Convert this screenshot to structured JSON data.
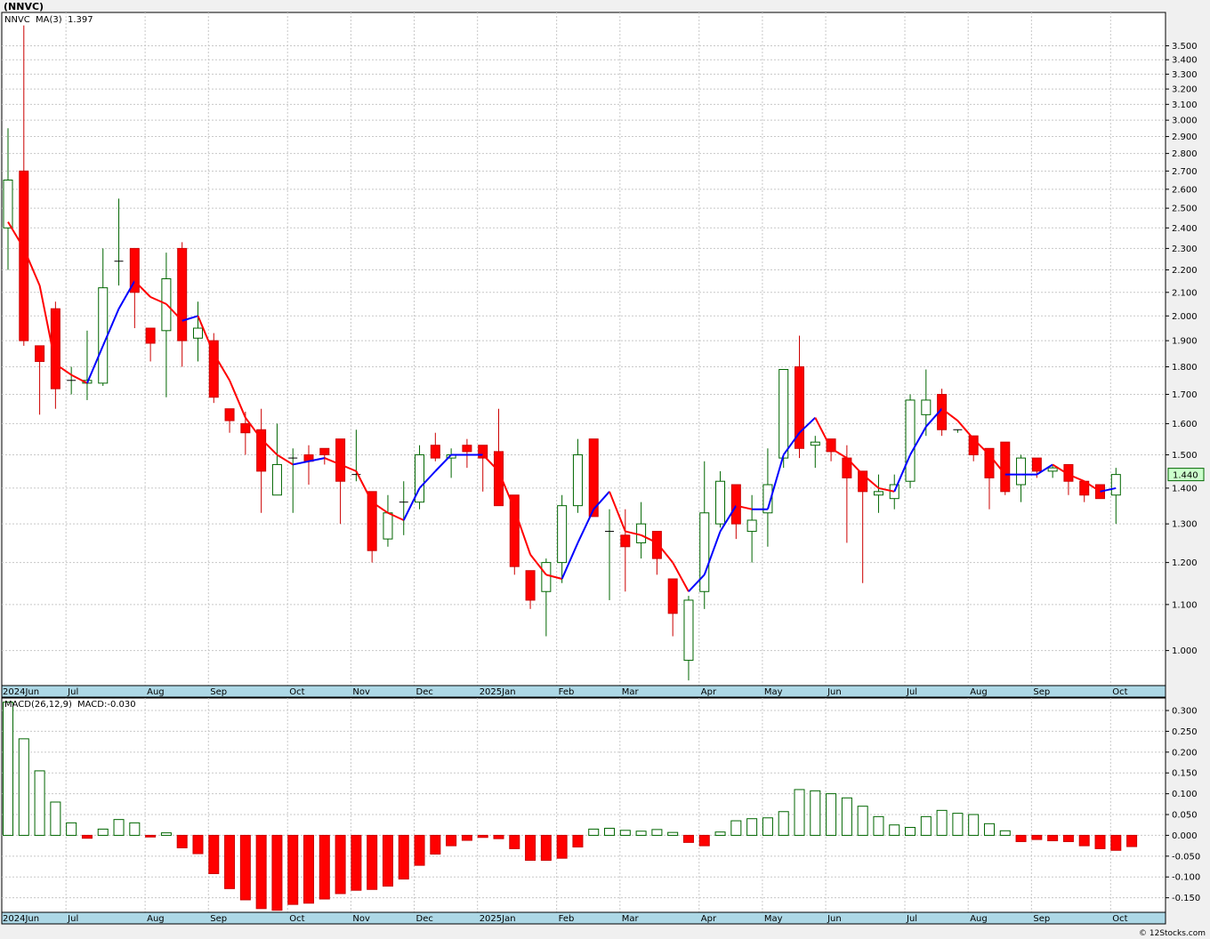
{
  "header": {
    "symbol": "(NNVC)",
    "ticker": "NNVC",
    "ma_label": "MA(3)",
    "ma_value": "1.397",
    "price_tag": "1.440",
    "macd_label": "MACD(26,12,9)",
    "macd_value": "MACD:-0.030",
    "footer": "© 12Stocks.com"
  },
  "colors": {
    "up": "#006600",
    "down": "#ff0000",
    "ma_up": "#0000ff",
    "ma_down": "#ff0000",
    "grid": "#c8c8c8",
    "axis_band": "#add8e6",
    "price_tag_bg": "#ccffcc"
  },
  "chart_data": [
    {
      "type": "candlestick",
      "scale": "log",
      "period": "weekly",
      "ylim": [
        0.93,
        3.75
      ],
      "y_ticks": [
        "1.000",
        "1.100",
        "1.200",
        "1.300",
        "1.400",
        "1.500",
        "1.600",
        "1.700",
        "1.800",
        "1.900",
        "2.000",
        "2.100",
        "2.200",
        "2.300",
        "2.400",
        "2.500",
        "2.600",
        "2.700",
        "2.800",
        "2.900",
        "3.000",
        "3.100",
        "3.200",
        "3.300",
        "3.400",
        "3.500"
      ],
      "x_labels": [
        "2024Jun",
        "Jul",
        "Aug",
        "Sep",
        "Oct",
        "Nov",
        "Dec",
        "2025Jan",
        "Feb",
        "Mar",
        "Apr",
        "May",
        "Jun",
        "Jul",
        "Aug",
        "Sep",
        "Oct"
      ],
      "x_label_week_index": [
        0,
        4,
        9,
        13,
        18,
        22,
        26,
        30,
        35,
        39,
        44,
        48,
        52,
        57,
        61,
        65,
        70
      ],
      "ohlc": [
        [
          2.4,
          2.95,
          2.2,
          2.65
        ],
        [
          2.7,
          3.65,
          1.88,
          1.9
        ],
        [
          1.88,
          1.88,
          1.63,
          1.82
        ],
        [
          2.03,
          2.06,
          1.65,
          1.72
        ],
        [
          1.75,
          1.8,
          1.7,
          1.75
        ],
        [
          1.74,
          1.94,
          1.68,
          1.75
        ],
        [
          1.74,
          2.3,
          1.73,
          2.12
        ],
        [
          2.24,
          2.55,
          2.13,
          2.24
        ],
        [
          2.3,
          2.3,
          1.95,
          2.1
        ],
        [
          1.95,
          1.95,
          1.82,
          1.89
        ],
        [
          1.94,
          2.28,
          1.69,
          2.16
        ],
        [
          2.3,
          2.33,
          1.8,
          1.9
        ],
        [
          1.91,
          2.06,
          1.82,
          1.95
        ],
        [
          1.9,
          1.93,
          1.67,
          1.69
        ],
        [
          1.65,
          1.65,
          1.57,
          1.61
        ],
        [
          1.6,
          1.64,
          1.5,
          1.57
        ],
        [
          1.58,
          1.65,
          1.33,
          1.45
        ],
        [
          1.38,
          1.6,
          1.38,
          1.47
        ],
        [
          1.49,
          1.52,
          1.33,
          1.49
        ],
        [
          1.5,
          1.53,
          1.41,
          1.48
        ],
        [
          1.52,
          1.52,
          1.47,
          1.5
        ],
        [
          1.55,
          1.55,
          1.3,
          1.42
        ],
        [
          1.44,
          1.58,
          1.42,
          1.44
        ],
        [
          1.39,
          1.39,
          1.2,
          1.23
        ],
        [
          1.26,
          1.38,
          1.24,
          1.33
        ],
        [
          1.36,
          1.42,
          1.27,
          1.36
        ],
        [
          1.36,
          1.53,
          1.34,
          1.5
        ],
        [
          1.53,
          1.57,
          1.48,
          1.49
        ],
        [
          1.49,
          1.52,
          1.43,
          1.5
        ],
        [
          1.53,
          1.55,
          1.46,
          1.51
        ],
        [
          1.53,
          1.53,
          1.39,
          1.49
        ],
        [
          1.51,
          1.65,
          1.36,
          1.35
        ],
        [
          1.38,
          1.38,
          1.17,
          1.19
        ],
        [
          1.18,
          1.18,
          1.09,
          1.11
        ],
        [
          1.13,
          1.21,
          1.03,
          1.2
        ],
        [
          1.2,
          1.38,
          1.15,
          1.35
        ],
        [
          1.35,
          1.55,
          1.33,
          1.5
        ],
        [
          1.55,
          1.55,
          1.32,
          1.32
        ],
        [
          1.28,
          1.34,
          1.11,
          1.28
        ],
        [
          1.27,
          1.34,
          1.13,
          1.24
        ],
        [
          1.25,
          1.36,
          1.21,
          1.3
        ],
        [
          1.28,
          1.28,
          1.17,
          1.21
        ],
        [
          1.16,
          1.16,
          1.03,
          1.08
        ],
        [
          0.98,
          1.12,
          0.94,
          1.11
        ],
        [
          1.13,
          1.48,
          1.09,
          1.33
        ],
        [
          1.3,
          1.45,
          1.29,
          1.42
        ],
        [
          1.41,
          1.41,
          1.26,
          1.3
        ],
        [
          1.28,
          1.38,
          1.2,
          1.31
        ],
        [
          1.33,
          1.52,
          1.24,
          1.41
        ],
        [
          1.49,
          1.79,
          1.46,
          1.79
        ],
        [
          1.8,
          1.92,
          1.49,
          1.52
        ],
        [
          1.53,
          1.56,
          1.46,
          1.54
        ],
        [
          1.55,
          1.55,
          1.48,
          1.51
        ],
        [
          1.49,
          1.53,
          1.25,
          1.43
        ],
        [
          1.45,
          1.45,
          1.15,
          1.39
        ],
        [
          1.38,
          1.44,
          1.33,
          1.39
        ],
        [
          1.37,
          1.44,
          1.34,
          1.41
        ],
        [
          1.42,
          1.7,
          1.4,
          1.68
        ],
        [
          1.63,
          1.79,
          1.56,
          1.68
        ],
        [
          1.7,
          1.72,
          1.56,
          1.58
        ],
        [
          1.58,
          1.58,
          1.57,
          1.58
        ],
        [
          1.56,
          1.56,
          1.48,
          1.5
        ],
        [
          1.52,
          1.52,
          1.34,
          1.43
        ],
        [
          1.54,
          1.54,
          1.38,
          1.39
        ],
        [
          1.41,
          1.5,
          1.36,
          1.49
        ],
        [
          1.49,
          1.49,
          1.43,
          1.45
        ],
        [
          1.45,
          1.47,
          1.43,
          1.46
        ],
        [
          1.47,
          1.47,
          1.38,
          1.42
        ],
        [
          1.42,
          1.42,
          1.36,
          1.38
        ],
        [
          1.41,
          1.41,
          1.37,
          1.37
        ],
        [
          1.38,
          1.46,
          1.3,
          1.44
        ]
      ],
      "ma3": [
        2.43,
        2.3,
        2.13,
        1.81,
        1.77,
        1.74,
        1.88,
        2.03,
        2.15,
        2.08,
        2.05,
        1.98,
        2.0,
        1.85,
        1.75,
        1.62,
        1.55,
        1.5,
        1.47,
        1.48,
        1.49,
        1.47,
        1.45,
        1.36,
        1.33,
        1.31,
        1.4,
        1.45,
        1.5,
        1.5,
        1.5,
        1.45,
        1.34,
        1.22,
        1.17,
        1.16,
        1.25,
        1.34,
        1.39,
        1.28,
        1.27,
        1.25,
        1.2,
        1.13,
        1.17,
        1.28,
        1.35,
        1.34,
        1.34,
        1.5,
        1.57,
        1.62,
        1.52,
        1.49,
        1.44,
        1.4,
        1.39,
        1.5,
        1.59,
        1.65,
        1.61,
        1.55,
        1.5,
        1.44,
        1.44,
        1.44,
        1.47,
        1.44,
        1.42,
        1.39,
        1.4
      ]
    },
    {
      "type": "bar",
      "name": "MACD(26,12,9)",
      "ylim": [
        -0.185,
        0.33
      ],
      "y_ticks": [
        "-0.150",
        "-0.100",
        "-0.050",
        "0.000",
        "0.050",
        "0.100",
        "0.150",
        "0.200",
        "0.250",
        "0.300"
      ],
      "x_labels": [
        "2024Jun",
        "Jul",
        "Aug",
        "Sep",
        "Oct",
        "Nov",
        "Dec",
        "2025Jan",
        "Feb",
        "Mar",
        "Apr",
        "May",
        "Jun",
        "Jul",
        "Aug",
        "Sep",
        "Oct"
      ],
      "values": [
        0.32,
        0.232,
        0.155,
        0.08,
        0.03,
        -0.007,
        0.015,
        0.038,
        0.03,
        -0.004,
        0.006,
        -0.03,
        -0.044,
        -0.092,
        -0.128,
        -0.155,
        -0.176,
        -0.18,
        -0.166,
        -0.163,
        -0.153,
        -0.14,
        -0.132,
        -0.13,
        -0.122,
        -0.105,
        -0.072,
        -0.045,
        -0.025,
        -0.012,
        -0.005,
        -0.008,
        -0.032,
        -0.06,
        -0.06,
        -0.055,
        -0.028,
        0.015,
        0.017,
        0.012,
        0.01,
        0.014,
        0.007,
        -0.017,
        -0.025,
        0.008,
        0.035,
        0.04,
        0.042,
        0.057,
        0.11,
        0.107,
        0.1,
        0.09,
        0.07,
        0.045,
        0.025,
        0.019,
        0.045,
        0.06,
        0.053,
        0.05,
        0.028,
        0.011,
        -0.015,
        -0.01,
        -0.013,
        -0.015,
        -0.025,
        -0.032,
        -0.036,
        -0.027
      ]
    }
  ]
}
